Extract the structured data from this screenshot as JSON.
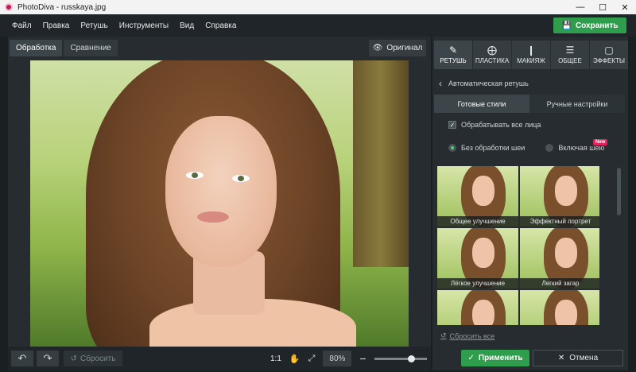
{
  "window": {
    "title": "PhotoDiva - russkaya.jpg",
    "minimize": "—",
    "maximize": "☐",
    "close": "✕"
  },
  "menu": {
    "items": [
      "Файл",
      "Правка",
      "Ретушь",
      "Инструменты",
      "Вид",
      "Справка"
    ],
    "save_label": "Сохранить"
  },
  "canvas": {
    "tabs": [
      {
        "label": "Обработка",
        "active": true
      },
      {
        "label": "Сравнение",
        "active": false
      }
    ],
    "original_label": "Оригинал"
  },
  "bottom": {
    "reset_label": "Сбросить",
    "zoom_1to1": "1:1",
    "zoom_value": "80%",
    "zoom_level": 0.7
  },
  "panel": {
    "categories": [
      {
        "label": "РЕТУШЬ",
        "icon": "retouch-icon",
        "active": true
      },
      {
        "label": "ПЛАСТИКА",
        "icon": "liquify-icon",
        "active": false
      },
      {
        "label": "МАКИЯЖ",
        "icon": "makeup-icon",
        "active": false
      },
      {
        "label": "ОБЩЕЕ",
        "icon": "sliders-icon",
        "active": false
      },
      {
        "label": "ЭФФЕКТЫ",
        "icon": "effects-icon",
        "active": false
      }
    ],
    "breadcrumb": "Автоматическая ретушь",
    "subtabs": [
      {
        "label": "Готовые стили",
        "active": true
      },
      {
        "label": "Ручные настройки",
        "active": false
      }
    ],
    "process_all_faces": "Обрабатывать все лица",
    "radio_no_neck": "Без обработки шеи",
    "radio_with_neck": "Включая шею",
    "new_badge": "New",
    "presets": [
      "Общее улучшение",
      "Эффектный портрет",
      "Лёгкое улучшение",
      "Легкий загар",
      "",
      ""
    ],
    "reset_all": "Сбросить все"
  },
  "footer": {
    "apply_label": "Применить",
    "cancel_label": "Отмена"
  }
}
